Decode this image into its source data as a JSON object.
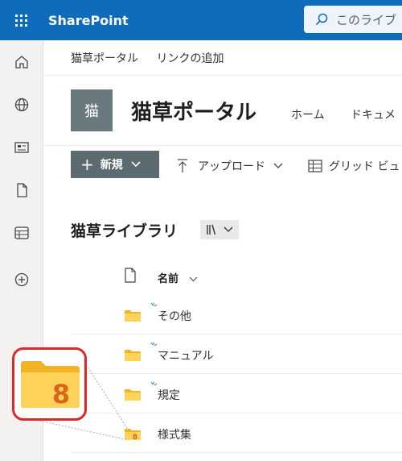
{
  "header": {
    "app_name": "SharePoint",
    "search_placeholder": "このライブ"
  },
  "rail": {
    "icons": [
      "home-icon",
      "globe-icon",
      "news-icon",
      "file-icon",
      "list-icon",
      "add-circle-icon"
    ]
  },
  "breadcrumb": {
    "items": [
      "猫草ポータル",
      "リンクの追加"
    ]
  },
  "site": {
    "logo_text": "猫",
    "title": "猫草ポータル",
    "nav": [
      "ホーム",
      "ドキュメ"
    ]
  },
  "toolbar": {
    "new_label": "新規",
    "upload_label": "アップロード",
    "grid_view_label": "グリッド ビュ"
  },
  "library": {
    "title": "猫草ライブラリ",
    "column_name": "名前",
    "rows": [
      {
        "name": "その他",
        "icon": "folder-icon",
        "new": true
      },
      {
        "name": "マニュアル",
        "icon": "folder-icon",
        "new": true
      },
      {
        "name": "規定",
        "icon": "folder-icon",
        "new": true
      },
      {
        "name": "様式集",
        "icon": "shared-folder-icon",
        "new": false
      }
    ]
  },
  "callout": {
    "icon": "shared-folder-icon",
    "digit": "8"
  },
  "colors": {
    "suite_bar": "#0f6cbd",
    "folder": "#ffd35a",
    "folder_dark": "#f0b429",
    "accent_orange": "#d9651b",
    "callout_border": "#e02727",
    "new_button": "#5b6b70",
    "site_logo": "#69797e"
  }
}
